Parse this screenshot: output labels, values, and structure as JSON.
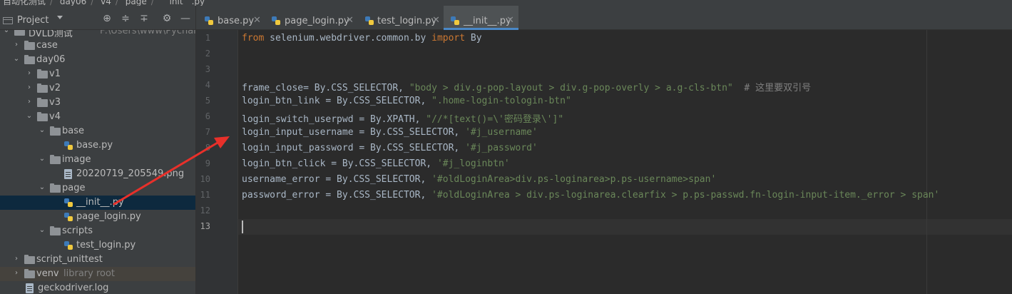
{
  "breadcrumb": [
    "自动化测试",
    "day06",
    "v4",
    "page",
    "__init__.py"
  ],
  "project_panel": {
    "title": "Project",
    "root_label": "DVLD测试",
    "root_path": "F:\\Users\\www\\PycharmProjects",
    "tree": [
      {
        "label": "case",
        "type": "folder",
        "depth": 1,
        "expanded": false
      },
      {
        "label": "day06",
        "type": "folder",
        "depth": 1,
        "expanded": true
      },
      {
        "label": "v1",
        "type": "folder",
        "depth": 2,
        "expanded": false
      },
      {
        "label": "v2",
        "type": "folder",
        "depth": 2,
        "expanded": false
      },
      {
        "label": "v3",
        "type": "folder",
        "depth": 2,
        "expanded": false
      },
      {
        "label": "v4",
        "type": "folder",
        "depth": 2,
        "expanded": true
      },
      {
        "label": "base",
        "type": "folder",
        "depth": 3,
        "expanded": true
      },
      {
        "label": "base.py",
        "type": "python",
        "depth": 4
      },
      {
        "label": "image",
        "type": "folder",
        "depth": 3,
        "expanded": true
      },
      {
        "label": "20220719_205549.png",
        "type": "image",
        "depth": 4
      },
      {
        "label": "page",
        "type": "folder",
        "depth": 3,
        "expanded": true
      },
      {
        "label": "__init__.py",
        "type": "python",
        "depth": 4,
        "selected": true
      },
      {
        "label": "page_login.py",
        "type": "python",
        "depth": 4
      },
      {
        "label": "scripts",
        "type": "folder",
        "depth": 3,
        "expanded": true
      },
      {
        "label": "test_login.py",
        "type": "python",
        "depth": 4
      },
      {
        "label": "script_unittest",
        "type": "folder",
        "depth": 1,
        "expanded": false
      },
      {
        "label": "venv",
        "type": "folder",
        "depth": 1,
        "expanded": false,
        "suffix": "library root",
        "library": true
      },
      {
        "label": "geckodriver.log",
        "type": "file",
        "depth": 1
      }
    ]
  },
  "tabs": [
    {
      "label": "base.py",
      "active": false
    },
    {
      "label": "page_login.py",
      "active": false
    },
    {
      "label": "test_login.py",
      "active": false
    },
    {
      "label": "__init__.py",
      "active": true
    }
  ],
  "editor": {
    "current_line": 13,
    "line_numbers": [
      "1",
      "2",
      "3",
      "4",
      "5",
      "6",
      "7",
      "8",
      "9",
      "10",
      "11",
      "12",
      "13"
    ],
    "lines": [
      [
        {
          "t": "kw",
          "v": "from"
        },
        {
          "t": "p",
          "v": " selenium.webdriver.common.by "
        },
        {
          "t": "kw",
          "v": "import"
        },
        {
          "t": "p",
          "v": " By"
        }
      ],
      [],
      [],
      [
        {
          "t": "p",
          "v": "frame_close= By.CSS_SELECTOR, "
        },
        {
          "t": "str",
          "v": "\"body > div.g-pop-layout > div.g-pop-overly > a.g-cls-btn\""
        },
        {
          "t": "p",
          "v": "  "
        },
        {
          "t": "cm",
          "v": "# 这里要双引号"
        }
      ],
      [
        {
          "t": "p",
          "v": "login_btn_link = By.CSS_SELECTOR, "
        },
        {
          "t": "str",
          "v": "\".home-login-tologin-btn\""
        }
      ],
      [
        {
          "t": "p",
          "v": "login_switch_userpwd = By.XPATH, "
        },
        {
          "t": "str",
          "v": "\"//*[text()=\\'密码登录\\']\""
        }
      ],
      [
        {
          "t": "p",
          "v": "login_input_username = By.CSS_SELECTOR, "
        },
        {
          "t": "str",
          "v": "'#j_username'"
        }
      ],
      [
        {
          "t": "p",
          "v": "login_input_password = By.CSS_SELECTOR, "
        },
        {
          "t": "str",
          "v": "'#j_password'"
        }
      ],
      [
        {
          "t": "p",
          "v": "login_btn_click = By.CSS_SELECTOR, "
        },
        {
          "t": "str",
          "v": "'#j_loginbtn'"
        }
      ],
      [
        {
          "t": "p",
          "v": "username_error = By.CSS_SELECTOR, "
        },
        {
          "t": "str",
          "v": "'#oldLoginArea>div.ps-loginarea>p.ps-username>span'"
        }
      ],
      [
        {
          "t": "p",
          "v": "password_error = By.CSS_SELECTOR, "
        },
        {
          "t": "str",
          "v": "'#oldLoginArea > div.ps-loginarea.clearfix > p.ps-passwd.fn-login-input-item._error > span'"
        }
      ],
      [],
      []
    ]
  },
  "colors": {
    "keyword": "#cc7832",
    "string": "#6a8759",
    "comment": "#808080",
    "annotation_arrow": "#e8302a"
  }
}
